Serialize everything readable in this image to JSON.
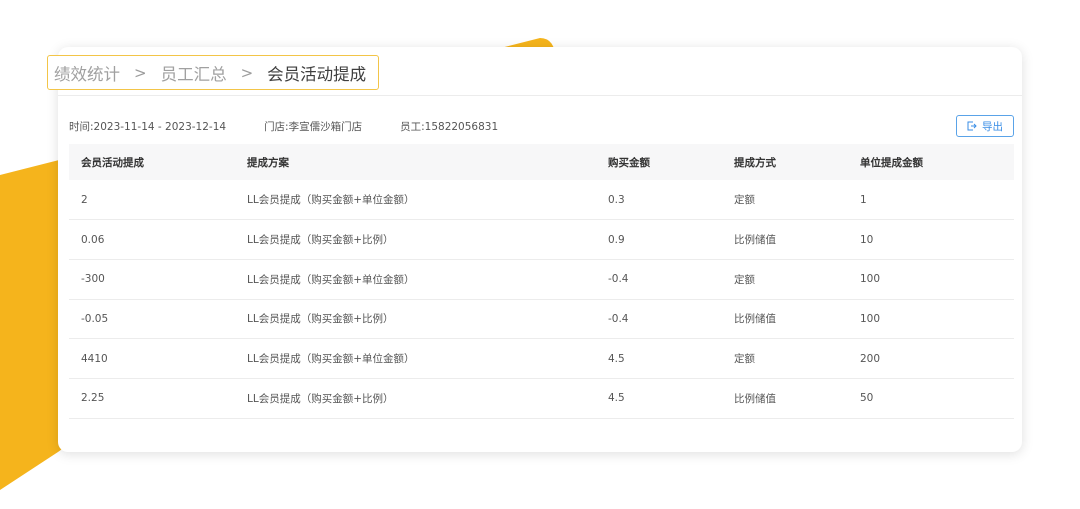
{
  "breadcrumb": {
    "items": [
      "绩效统计",
      "员工汇总",
      "会员活动提成"
    ],
    "separator": ">"
  },
  "filters": {
    "time_label": "时间:",
    "time_value": "2023-11-14 - 2023-12-14",
    "store_label": "门店:",
    "store_value": "李宣儒沙箱门店",
    "employee_label": "员工:",
    "employee_value": "15822056831"
  },
  "export_button": {
    "label": "导出",
    "icon": "export-icon"
  },
  "table": {
    "headers": [
      "会员活动提成",
      "提成方案",
      "购买金额",
      "提成方式",
      "单位提成金额"
    ],
    "rows": [
      [
        "2",
        "LL会员提成（购买金额+单位金额）",
        "0.3",
        "定额",
        "1"
      ],
      [
        "0.06",
        "LL会员提成（购买金额+比例）",
        "0.9",
        "比例储值",
        "10"
      ],
      [
        "-300",
        "LL会员提成（购买金额+单位金额）",
        "-0.4",
        "定额",
        "100"
      ],
      [
        "-0.05",
        "LL会员提成（购买金额+比例）",
        "-0.4",
        "比例储值",
        "100"
      ],
      [
        "4410",
        "LL会员提成（购买金额+单位金额）",
        "4.5",
        "定额",
        "200"
      ],
      [
        "2.25",
        "LL会员提成（购买金额+比例）",
        "4.5",
        "比例储值",
        "50"
      ]
    ]
  },
  "colors": {
    "accent_yellow": "#f5b41c",
    "primary_blue": "#3a8ee6",
    "highlight_border": "#f3c548"
  }
}
